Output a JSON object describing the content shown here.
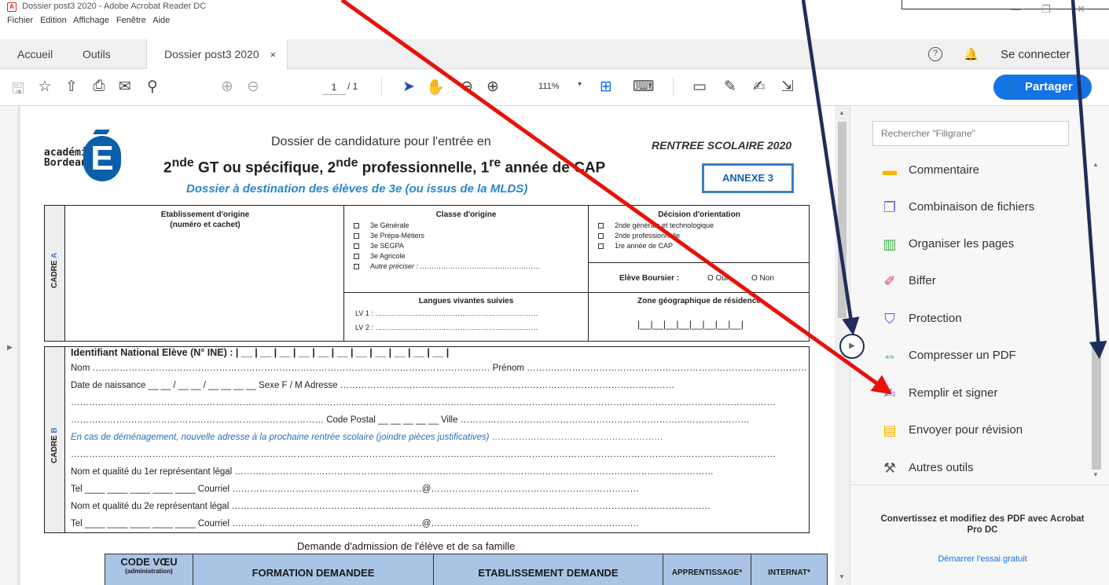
{
  "window": {
    "title": "Dossier post3 2020 - Adobe Acrobat Reader DC",
    "min_glyph": "—",
    "max_glyph": "❐",
    "close_glyph": "✕"
  },
  "menu": [
    "Fichier",
    "Edition",
    "Affichage",
    "Fenêtre",
    "Aide"
  ],
  "tabs": {
    "home": "Accueil",
    "tools": "Outils",
    "document": "Dossier post3 2020",
    "close": "×"
  },
  "header": {
    "help": "?",
    "signin": "Se connecter"
  },
  "toolbar": {
    "page_current": "1",
    "page_total": "/ 1",
    "zoom": "111%",
    "zoom_caret": "▾",
    "share": "Partager"
  },
  "document": {
    "logo_text": "académie\nBordeaux",
    "logo_letter": "E",
    "heading1": "Dossier de candidature pour l'entrée en",
    "heading2_parts": [
      "2",
      "nde",
      " GT ou spécifique, 2",
      "nde",
      " professionnelle, 1",
      "re",
      " année de CAP"
    ],
    "heading3": "Dossier à destination des élèves de 3e (ou issus de la MLDS)",
    "rentree": "RENTREE SCOLAIRE 2020",
    "annexe": "ANNEXE 3",
    "cadre_a": {
      "label_prefix": "CADRE",
      "label_letter": "A",
      "origin_head": "Etablissement d'origine",
      "origin_sub": "(numéro et cachet)",
      "classe_head": "Classe d'origine",
      "classe_items": [
        "3e Générale",
        "3e Prépa-Métiers",
        "3e SEGPA",
        "3e Agricole"
      ],
      "autre": "Autre",
      "preciser": "préciser : ……………………………………………",
      "decision_head": "Décision d'orientation",
      "decision_items": [
        "2nde générale et technologique",
        "2nde professionnelle",
        "1re année de CAP"
      ],
      "boursier_label": "Elève Boursier :",
      "boursier_yes": "O Oui",
      "boursier_no": "O Non",
      "langues_head": "Langues vivantes suivies",
      "lv1": "LV 1 : ……………………………………………………………",
      "lv2": "LV 2 : ……………………………………………………………",
      "zone_head": "Zone géographique de résidence",
      "zone_boxes": "|__|__|__|__|__|__|__|__|"
    },
    "cadre_b": {
      "label_prefix": "CADRE",
      "label_letter": "B",
      "ine": "Identifiant National Elève (N° INE) : | __ | __ | __ | __ | __ | __ | __ | __ | __ | __ | __ |",
      "nom": "Nom …………………………………………………………………………………………………………………… Prénom ……………………………………………………………………………………………",
      "naissance": "Date de naissance  __ __ / __ __ / __ __ __ __   Sexe  F / M       Adresse …………………………………………………………………………………………………",
      "blank1": "………………………………………………………………………………………………………………………………………………………………………………………………………………",
      "code_postal": "………………………………………………………………………… Code Postal  __ __ __ __ __   Ville ……………………………………………………………………………………",
      "demenagement": "En cas de déménagement, nouvelle adresse à la prochaine rentrée scolaire (joindre pièces justificatives) …………………………………………………",
      "blank2": "………………………………………………………………………………………………………………………………………………………………………………………………………………",
      "rep1": "Nom et qualité du 1er représentant légal ……………………………………………………………………………………………………………………………………………",
      "tel1": "Tel  ____ ____ ____ ____ ____      Courriel ………………………………………………………@……………………………………………………………",
      "rep2": "Nom et qualité du 2e représentant légal ……………………………………………………………………………………………………………………………………………",
      "tel2": "Tel  ____ ____ ____ ____ ____      Courriel ………………………………………………………@……………………………………………………………"
    },
    "demande": "Demande d'admission de l'élève et de sa famille",
    "columns": {
      "code": "CODE VŒU",
      "code_sub": "(administration)",
      "formation": "FORMATION DEMANDEE",
      "etablissement": "ETABLISSEMENT DEMANDE",
      "apprentissage": "APPRENTISSAGE*",
      "internat": "INTERNAT*"
    }
  },
  "right_panel": {
    "search_placeholder": "Rechercher \"Filigrane\"",
    "tools": [
      {
        "label": "Commentaire",
        "icon": "comment-icon",
        "color": "#f5b400"
      },
      {
        "label": "Combinaison de fichiers",
        "icon": "combine-files-icon",
        "color": "#6b5bd6"
      },
      {
        "label": "Organiser les pages",
        "icon": "organize-pages-icon",
        "color": "#3fae49"
      },
      {
        "label": "Biffer",
        "icon": "redact-icon",
        "color": "#d6336c"
      },
      {
        "label": "Protection",
        "icon": "shield-icon",
        "color": "#4b5bd6"
      },
      {
        "label": "Compresser un PDF",
        "icon": "compress-pdf-icon",
        "color": "#1e9e8a"
      },
      {
        "label": "Remplir et signer",
        "icon": "fill-sign-icon",
        "color": "#8e3fd1"
      },
      {
        "label": "Envoyer pour révision",
        "icon": "send-review-icon",
        "color": "#f5b400"
      },
      {
        "label": "Autres outils",
        "icon": "more-tools-icon",
        "color": "#555555"
      }
    ],
    "promo_title": "Convertissez et modifiez des PDF avec Acrobat Pro DC",
    "promo_link": "Démarrer l'essai gratuit"
  },
  "colors": {
    "accent": "#1473e6",
    "red_arrow": "#e8110d",
    "navy_arrow": "#1f2d5a",
    "table_header": "#a9c4e4"
  }
}
